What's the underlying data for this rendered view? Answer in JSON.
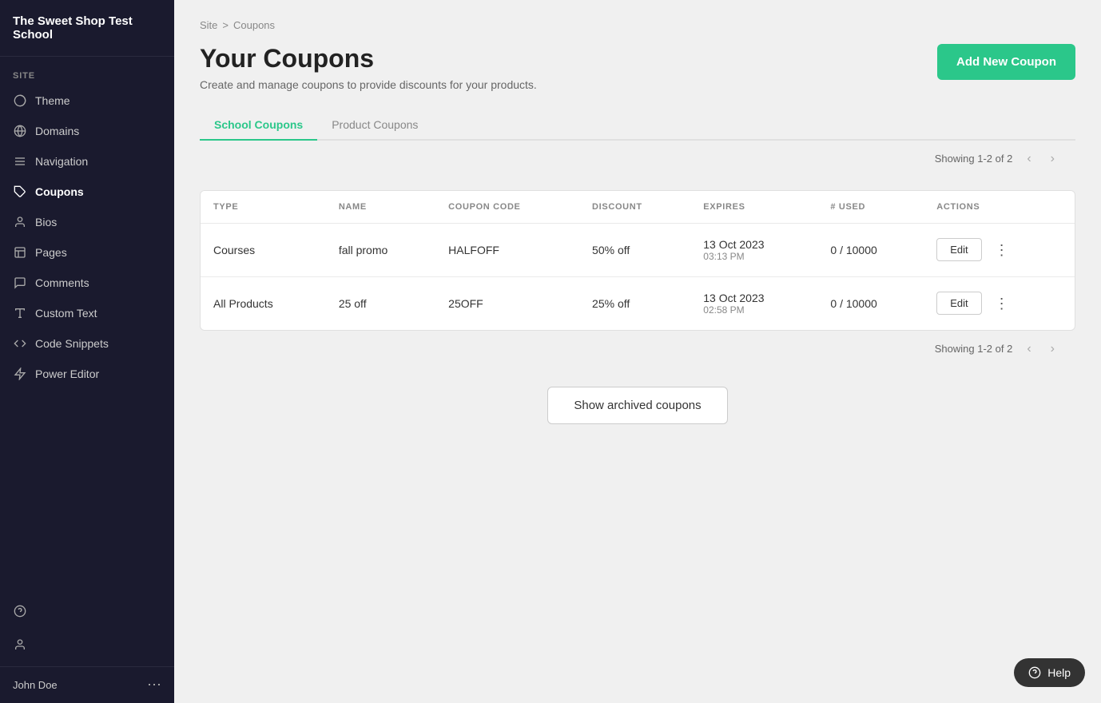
{
  "app": {
    "school_name": "The Sweet Shop Test School",
    "user_name": "John Doe"
  },
  "sidebar": {
    "section_label": "SITE",
    "items": [
      {
        "id": "theme",
        "label": "Theme",
        "icon": "🎨"
      },
      {
        "id": "domains",
        "label": "Domains",
        "icon": "🌐"
      },
      {
        "id": "navigation",
        "label": "Navigation",
        "icon": "☰"
      },
      {
        "id": "coupons",
        "label": "Coupons",
        "icon": "🏷",
        "active": true
      },
      {
        "id": "bios",
        "label": "Bios",
        "icon": "👤"
      },
      {
        "id": "pages",
        "label": "Pages",
        "icon": "📄"
      },
      {
        "id": "comments",
        "label": "Comments",
        "icon": "💬"
      },
      {
        "id": "custom-text",
        "label": "Custom Text",
        "icon": "✏️"
      },
      {
        "id": "code-snippets",
        "label": "Code Snippets",
        "icon": "{ }"
      },
      {
        "id": "power-editor",
        "label": "Power Editor",
        "icon": "⚡"
      }
    ],
    "bottom_icons": [
      {
        "id": "help-icon",
        "icon": "?"
      },
      {
        "id": "user-icon",
        "icon": "👤"
      }
    ]
  },
  "breadcrumb": {
    "site_label": "Site",
    "separator": ">",
    "current": "Coupons"
  },
  "header": {
    "title": "Your Coupons",
    "subtitle": "Create and manage coupons to provide discounts for your products.",
    "add_button_label": "Add New Coupon"
  },
  "tabs": [
    {
      "id": "school-coupons",
      "label": "School Coupons",
      "active": true
    },
    {
      "id": "product-coupons",
      "label": "Product Coupons",
      "active": false
    }
  ],
  "table": {
    "pagination_text": "Showing 1-2 of 2",
    "columns": [
      {
        "key": "type",
        "label": "TYPE"
      },
      {
        "key": "name",
        "label": "NAME"
      },
      {
        "key": "coupon_code",
        "label": "COUPON CODE"
      },
      {
        "key": "discount",
        "label": "DISCOUNT"
      },
      {
        "key": "expires",
        "label": "EXPIRES"
      },
      {
        "key": "used",
        "label": "# USED"
      },
      {
        "key": "actions",
        "label": "ACTIONS"
      }
    ],
    "rows": [
      {
        "type": "Courses",
        "name": "fall promo",
        "coupon_code": "HALFOFF",
        "discount": "50% off",
        "expires": "13 Oct 2023\n03:13 PM",
        "expires_line1": "13 Oct 2023",
        "expires_line2": "03:13 PM",
        "used": "0 / 10000"
      },
      {
        "type": "All Products",
        "name": "25 off",
        "coupon_code": "25OFF",
        "discount": "25% off",
        "expires": "13 Oct 2023\n02:58 PM",
        "expires_line1": "13 Oct 2023",
        "expires_line2": "02:58 PM",
        "used": "0 / 10000"
      }
    ],
    "edit_btn_label": "Edit",
    "more_btn_label": "⋮"
  },
  "archived": {
    "button_label": "Show archived coupons"
  },
  "help": {
    "button_label": "Help"
  }
}
